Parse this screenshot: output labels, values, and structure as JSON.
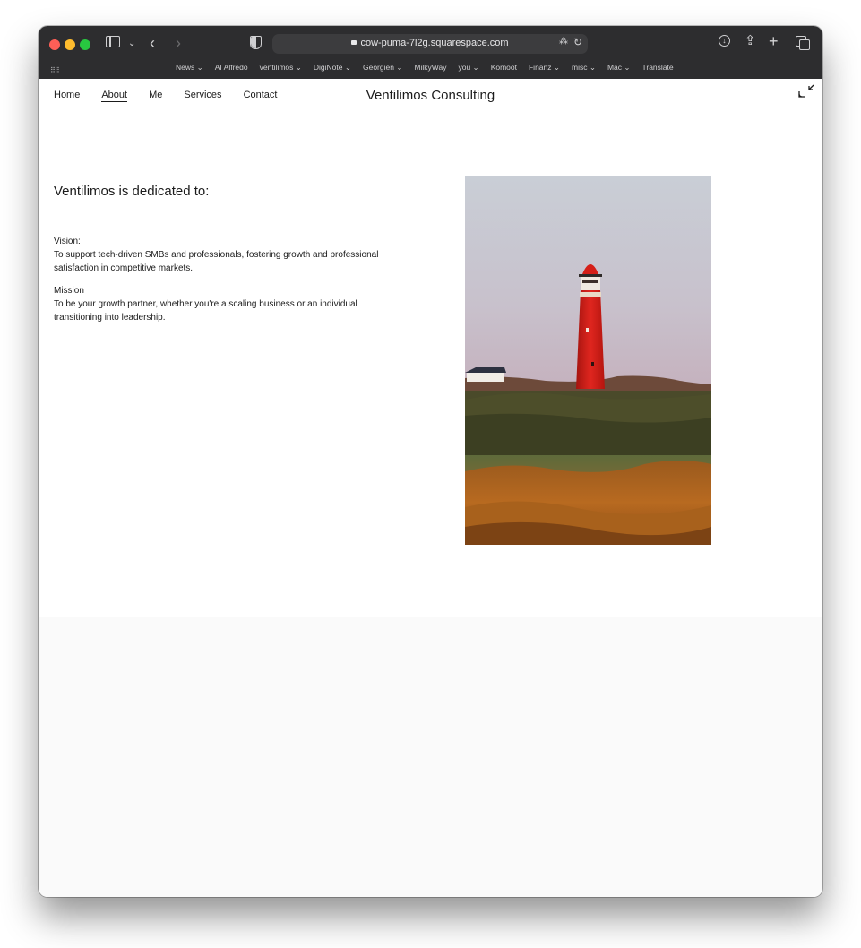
{
  "browser": {
    "url": "cow-puma-7l2g.squarespace.com",
    "bookmarks": [
      "News ⌄",
      "AI Alfredo",
      "ventilimos ⌄",
      "DigiNote ⌄",
      "Georgien ⌄",
      "MilkyWay",
      "you ⌄",
      "Komoot",
      "Finanz ⌄",
      "misc ⌄",
      "Mac ⌄",
      "Translate"
    ]
  },
  "site": {
    "title": "Ventilimos Consulting",
    "nav": [
      "Home",
      "About",
      "Me",
      "Services",
      "Contact"
    ],
    "active_nav": "About"
  },
  "content": {
    "heading": "Ventilimos is dedicated to:",
    "vision_label": "Vision:",
    "vision_text": "To support tech-driven SMBs and professionals, fostering growth and professional satisfaction in competitive markets.",
    "mission_label": "Mission",
    "mission_text": "To be your growth partner, whether you're a scaling business or an individual transitioning into leadership."
  },
  "colors": {
    "chrome": "#2d2d2f",
    "lighthouse": "#d8231e",
    "page_bg": "#ffffff",
    "footer_bg": "#fafafa"
  }
}
